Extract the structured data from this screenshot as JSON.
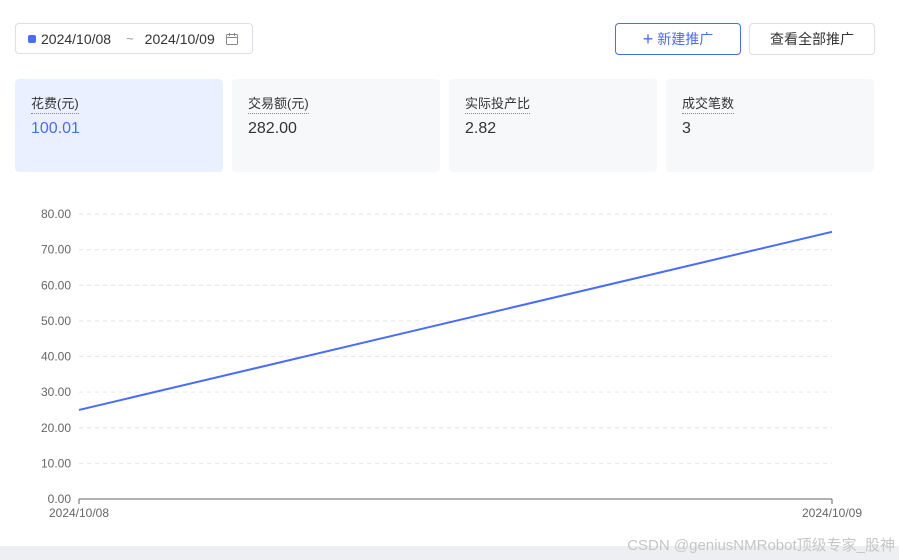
{
  "date_range": {
    "start": "2024/10/08",
    "separator": "~",
    "end": "2024/10/09"
  },
  "buttons": {
    "new_label": "新建推广",
    "view_all_label": "查看全部推广"
  },
  "metrics": [
    {
      "label": "花费(元)",
      "value": "100.01"
    },
    {
      "label": "交易额(元)",
      "value": "282.00"
    },
    {
      "label": "实际投产比",
      "value": "2.82"
    },
    {
      "label": "成交笔数",
      "value": "3"
    }
  ],
  "colors": {
    "accent": "#4a6cf7",
    "active_card_bg": "#eaf0ff",
    "card_bg": "#f7f8fa"
  },
  "chart_data": {
    "type": "line",
    "x": [
      "2024/10/08",
      "2024/10/09"
    ],
    "series": [
      {
        "values": [
          25,
          75
        ]
      }
    ],
    "ylim": [
      0,
      80
    ],
    "yticks": [
      "0.00",
      "10.00",
      "20.00",
      "30.00",
      "40.00",
      "50.00",
      "60.00",
      "70.00",
      "80.00"
    ],
    "grid": true,
    "color": "#4a6cf7"
  },
  "watermark": "CSDN @geniusNMRobot顶级专家_股神"
}
